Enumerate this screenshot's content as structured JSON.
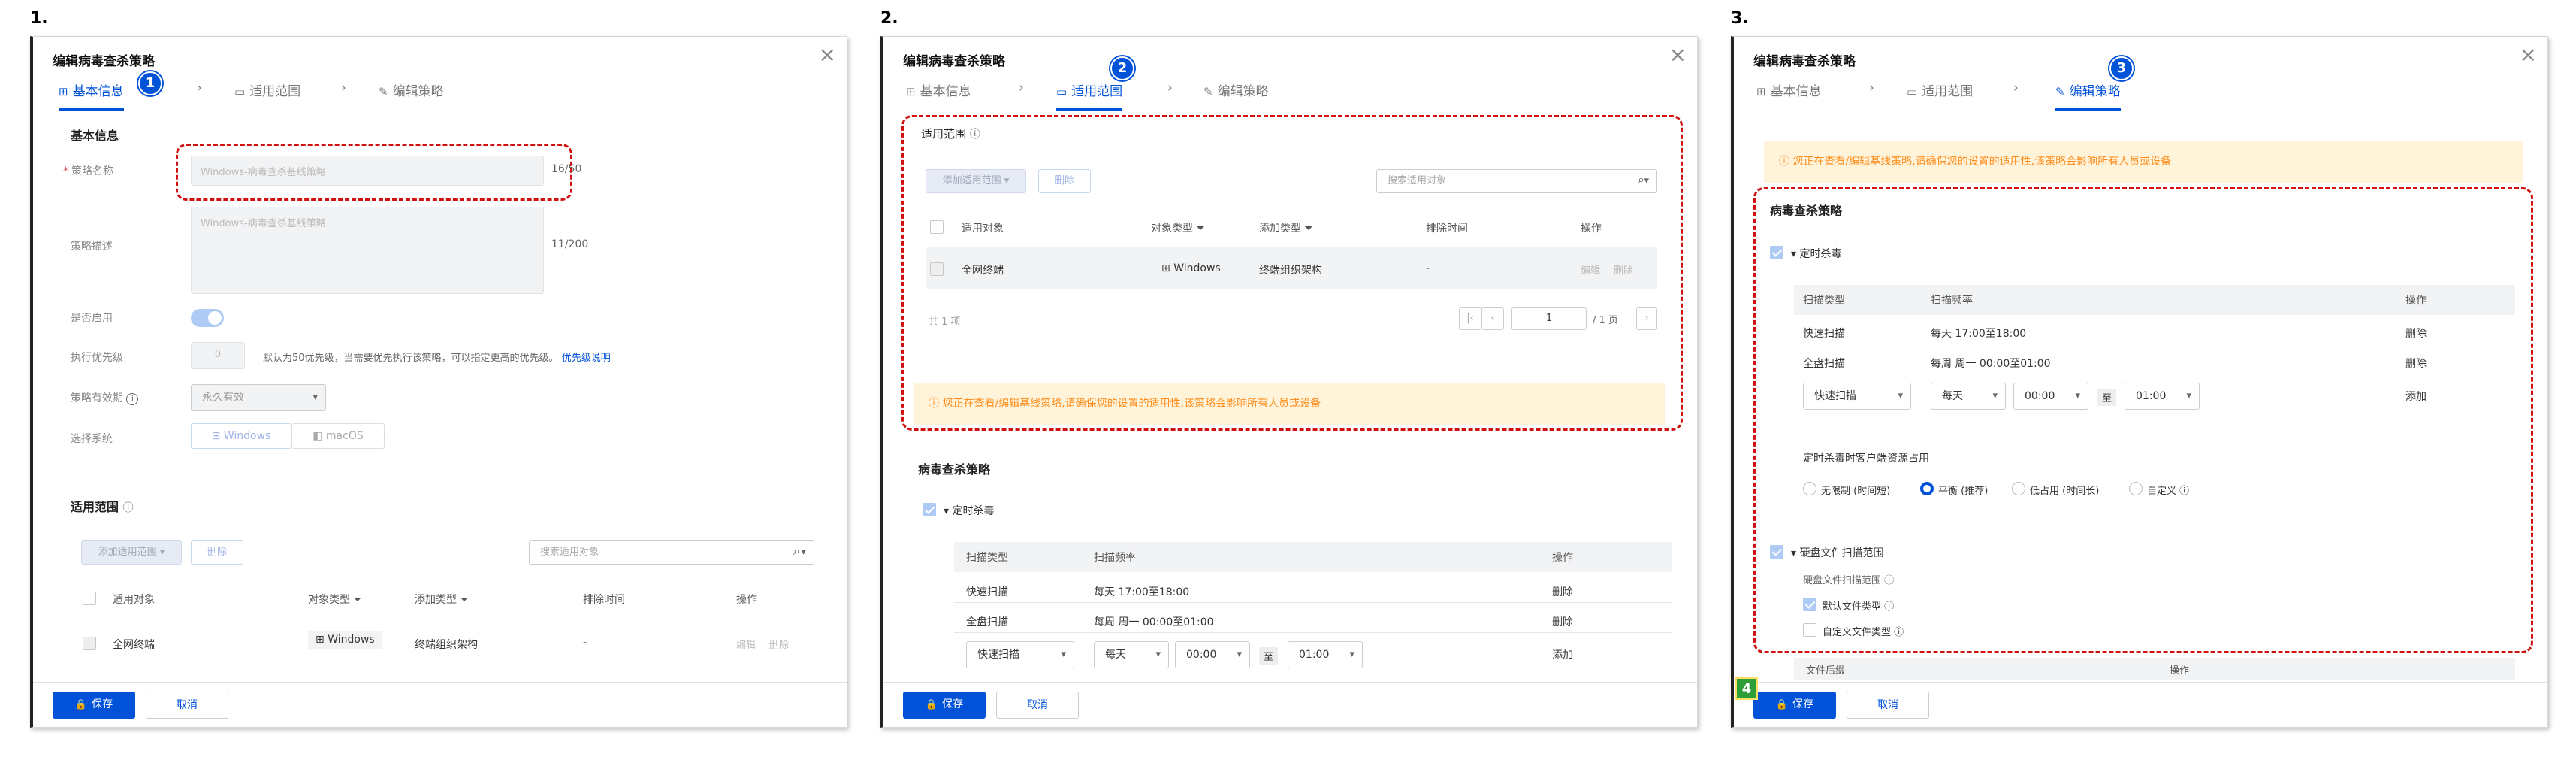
{
  "steps": [
    "1.",
    "2.",
    "3."
  ],
  "common": {
    "dialog_title": "编辑病毒查杀策略",
    "close": "×",
    "tabs": {
      "basic": "基本信息",
      "scope": "适用范围",
      "policy": "编辑策略"
    },
    "tab_arrow": "›",
    "save_label": "保存",
    "cancel_label": "取消"
  },
  "panel1": {
    "badge": "1",
    "section_basic": "基本信息",
    "name_label": "策略名称",
    "name_value": "Windows-病毒查杀基线策略",
    "name_count": "16/50",
    "desc_label": "策略描述",
    "desc_value": "Windows-病毒查杀基线策略",
    "desc_count": "11/200",
    "enable_label": "是否启用",
    "priority_label": "执行优先级",
    "priority_value": "0",
    "priority_hint": "默认为50优先级，当需要优先执行该策略，可以指定更高的优先级。",
    "priority_link": "优先级说明",
    "validity_label": "策略有效期",
    "validity_value": "永久有效",
    "os_label": "选择系统",
    "os_windows": "Windows",
    "os_mac": "macOS",
    "section_scope": "适用范围",
    "add_scope_btn": "添加适用范围",
    "delete_btn": "删除",
    "search_placeholder": "搜索适用对象",
    "cols": [
      "适用对象",
      "对象类型",
      "添加类型",
      "排除时间",
      "操作"
    ],
    "row": {
      "obj": "全网终端",
      "type": "Windows",
      "add": "终端组织架构",
      "excl": "-",
      "edit": "编辑",
      "del": "删除"
    }
  },
  "panel2": {
    "badge": "2",
    "section_scope": "适用范围",
    "add_scope_btn": "添加适用范围",
    "delete_btn": "删除",
    "search_placeholder": "搜索适用对象",
    "cols": [
      "适用对象",
      "对象类型",
      "添加类型",
      "排除时间",
      "操作"
    ],
    "row": {
      "obj": "全网终端",
      "type": "Windows",
      "add": "终端组织架构",
      "excl": "-",
      "edit": "编辑",
      "del": "删除"
    },
    "total": "共 1 项",
    "page_value": "1",
    "page_total": "/ 1 页",
    "warning": "您正在查看/编辑基线策略,请确保您的设置的适用性,该策略会影响所有人员或设备",
    "section_policy": "病毒查杀策略",
    "scheduled": "定时杀毒",
    "sched_cols": [
      "扫描类型",
      "扫描频率",
      "操作"
    ],
    "sched_rows": [
      {
        "type": "快速扫描",
        "freq": "每天 17:00至18:00",
        "op": "删除"
      },
      {
        "type": "全盘扫描",
        "freq": "每周 周一 00:00至01:00",
        "op": "删除"
      }
    ],
    "new_row": {
      "type": "快速扫描",
      "freq": "每天",
      "from": "00:00",
      "to_label": "至",
      "to": "01:00",
      "add": "添加"
    }
  },
  "panel3": {
    "badge": "3",
    "badge4": "4",
    "warning": "您正在查看/编辑基线策略,请确保您的设置的适用性,该策略会影响所有人员或设备",
    "section_policy": "病毒查杀策略",
    "scheduled": "定时杀毒",
    "sched_cols": [
      "扫描类型",
      "扫描频率",
      "操作"
    ],
    "sched_rows": [
      {
        "type": "快速扫描",
        "freq": "每天 17:00至18:00",
        "op": "删除"
      },
      {
        "type": "全盘扫描",
        "freq": "每周 周一 00:00至01:00",
        "op": "删除"
      }
    ],
    "new_row": {
      "type": "快速扫描",
      "freq": "每天",
      "from": "00:00",
      "to_label": "至",
      "to": "01:00",
      "add": "添加"
    },
    "resource_label": "定时杀毒时客户端资源占用",
    "resource_options": [
      "无限制 (时间短)",
      "平衡 (推荐)",
      "低占用 (时间长)",
      "自定义"
    ],
    "disk_scan": "硬盘文件扫描范围",
    "disk_scan_label": "硬盘文件扫描范围",
    "default_types": "默认文件类型",
    "custom_types": "自定义文件类型",
    "ext_cols": [
      "文件后缀",
      "操作"
    ]
  }
}
